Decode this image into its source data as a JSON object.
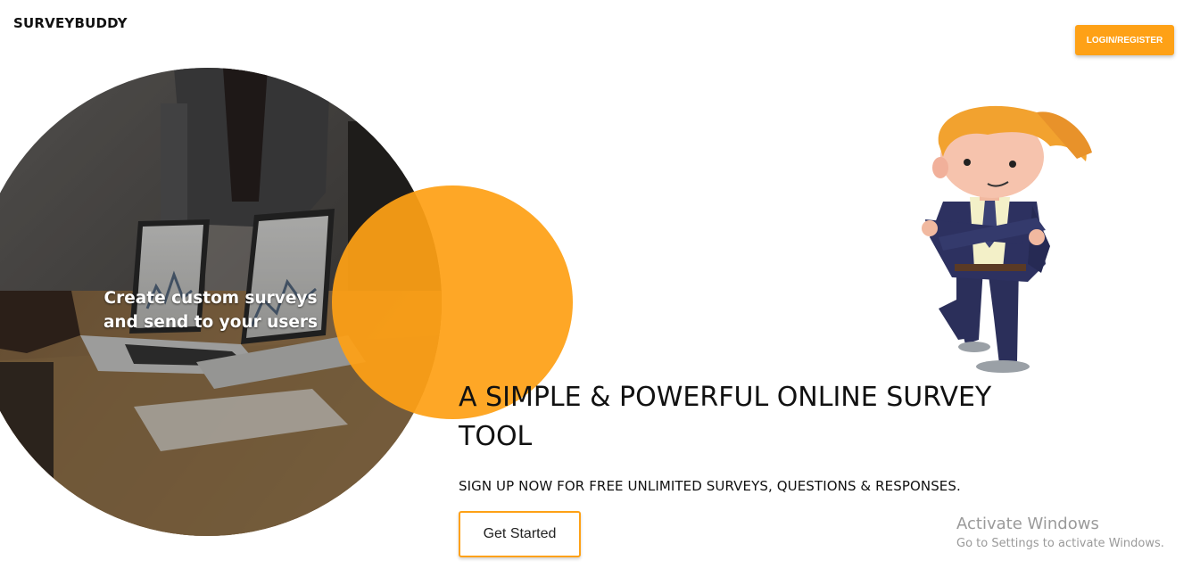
{
  "header": {
    "brand": "SURVEYBUDDY",
    "login_label": "LOGIN/REGISTER"
  },
  "hero": {
    "photo_caption": "Create custom surveys and send to your users",
    "headline": "A SIMPLE & POWERFUL ONLINE SURVEY TOOL",
    "subtitle": "SIGN UP NOW FOR FREE UNLIMITED SURVEYS, QUESTIONS & RESPONSES.",
    "cta_label": "Get Started"
  },
  "watermark": {
    "title": "Activate Windows",
    "subtitle": "Go to Settings to activate Windows."
  },
  "colors": {
    "accent": "#fea116",
    "text": "#111111",
    "watermark": "#9a9a9a"
  },
  "images": {
    "photo": "office-laptops-photo",
    "character": "cartoon-businessman-illustration"
  }
}
